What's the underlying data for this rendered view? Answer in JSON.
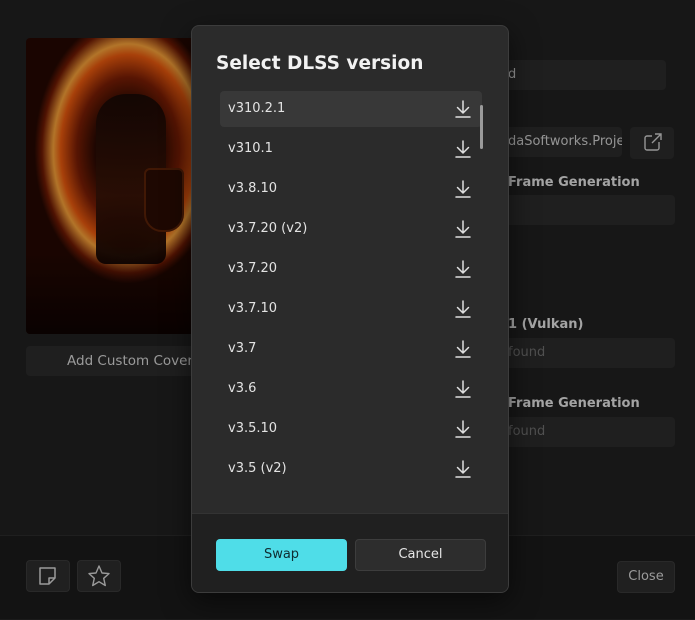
{
  "background": {
    "add_cover_label": "Add Custom Cover",
    "field_top_text": "d",
    "path_text": "daSoftworks.Projе",
    "label_frame_gen_1": "Frame Generation",
    "label_vulkan": "1 (Vulkan)",
    "vulkan_value": "found",
    "label_frame_gen_2": "Frame Generation",
    "frame_gen_2_value": "found",
    "close_label": "Close"
  },
  "dialog": {
    "title": "Select DLSS version",
    "items": [
      {
        "label": "v310.2.1",
        "selected": true
      },
      {
        "label": "v310.1"
      },
      {
        "label": "v3.8.10"
      },
      {
        "label": "v3.7.20 (v2)"
      },
      {
        "label": "v3.7.20"
      },
      {
        "label": "v3.7.10"
      },
      {
        "label": "v3.7"
      },
      {
        "label": "v3.6"
      },
      {
        "label": "v3.5.10"
      },
      {
        "label": "v3.5 (v2)"
      }
    ],
    "swap_label": "Swap",
    "cancel_label": "Cancel",
    "item_icon": "download-icon"
  },
  "colors": {
    "accent": "#4fdde8",
    "dialog_bg": "#2b2b2b",
    "app_bg": "#202020"
  }
}
